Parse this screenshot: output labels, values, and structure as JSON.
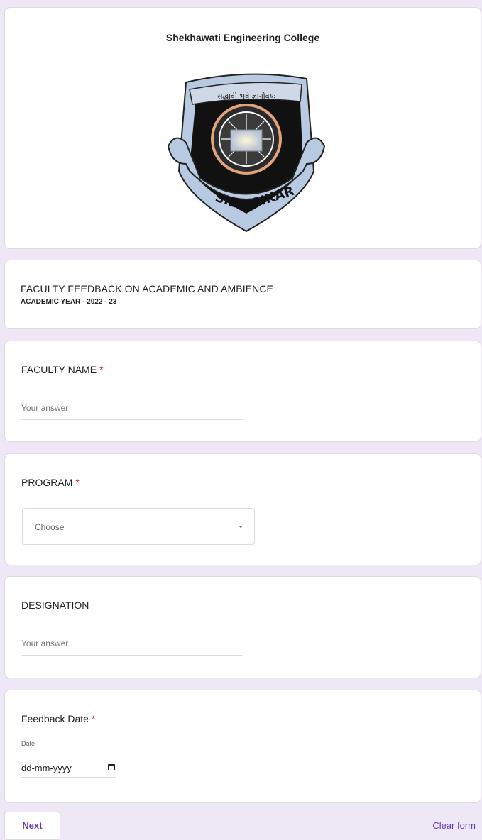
{
  "header": {
    "college_name": "Shekhawati Engineering College",
    "logo": {
      "motto": "सद्भावी भवे ज्ञानोदयः",
      "left_text": "SIET",
      "right_text": "SIKAR"
    }
  },
  "form": {
    "title": "FACULTY FEEDBACK ON  ACADEMIC AND AMBIENCE",
    "subtitle": "ACADEMIC YEAR - 2022 - 23"
  },
  "questions": {
    "faculty_name": {
      "label": "FACULTY NAME",
      "required_mark": "*",
      "placeholder": "Your answer"
    },
    "program": {
      "label": "PROGRAM",
      "required_mark": "*",
      "selected": "Choose"
    },
    "designation": {
      "label": "DESIGNATION",
      "placeholder": "Your answer"
    },
    "feedback_date": {
      "label": "Feedback Date",
      "required_mark": "*",
      "sublabel": "Date",
      "value": "dd-mm-yyyy"
    }
  },
  "footer": {
    "next_label": "Next",
    "clear_label": "Clear form"
  },
  "colors": {
    "background": "#ede7f6",
    "accent": "#673ab7",
    "required": "#d93025"
  }
}
